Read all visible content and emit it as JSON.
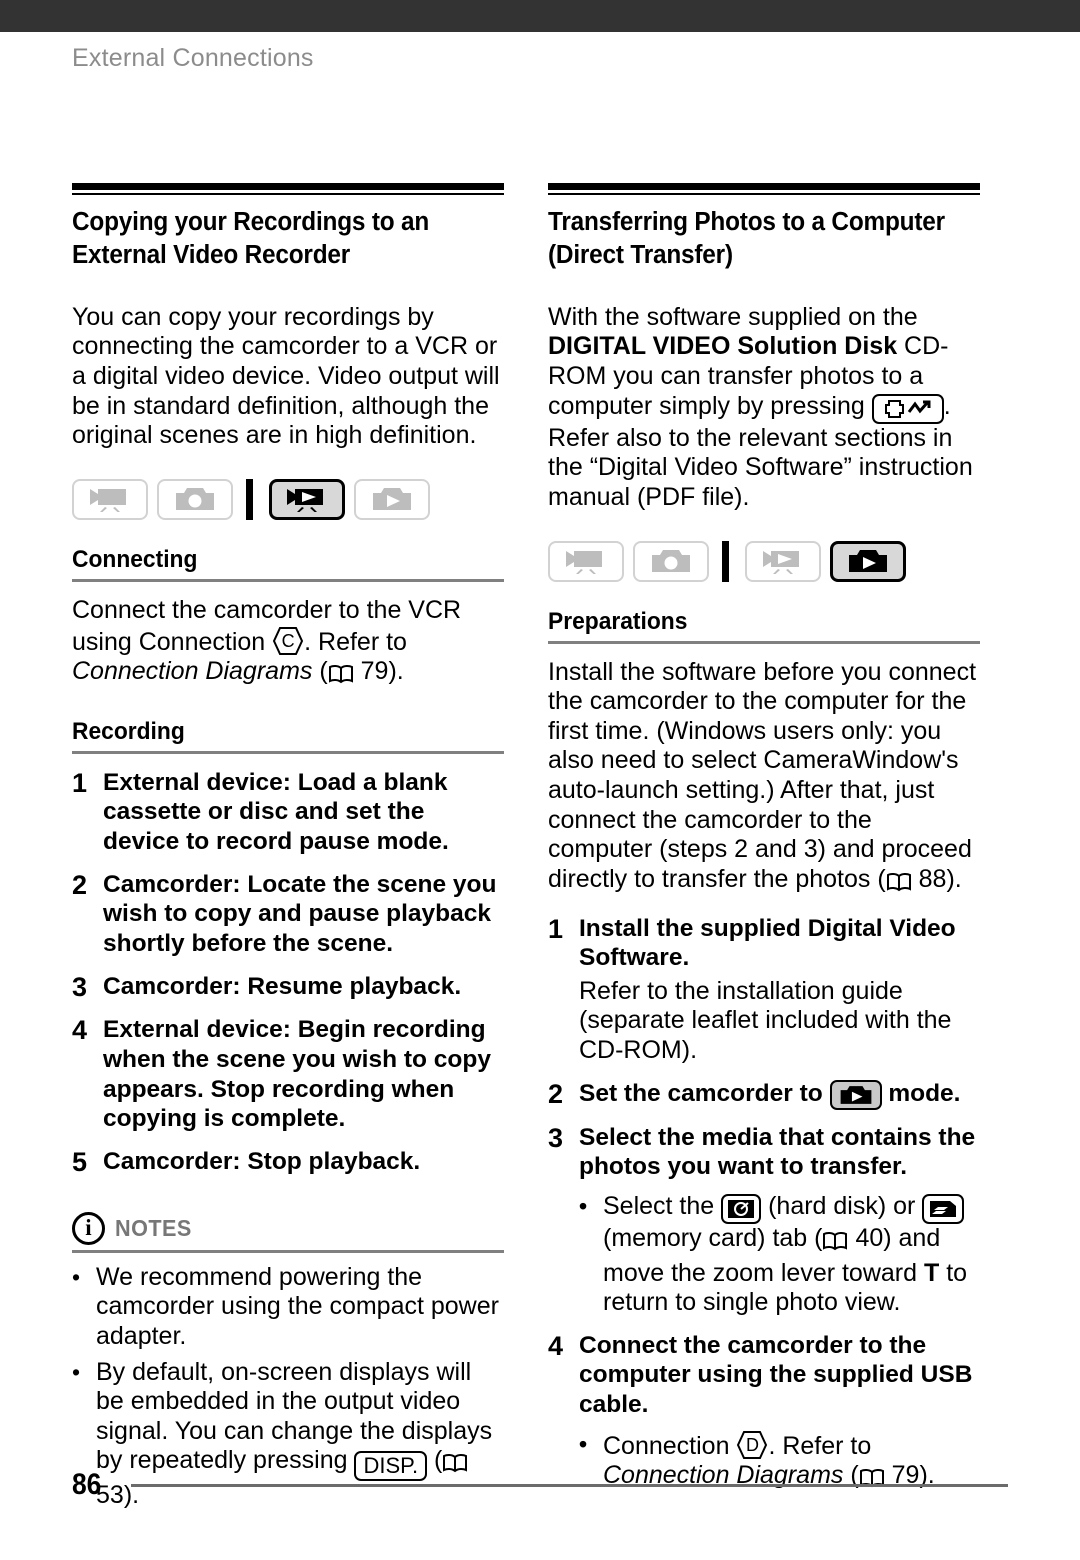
{
  "header": {
    "running_head": "External Connections"
  },
  "footer": {
    "page_number": "86"
  },
  "left_column": {
    "section_title": "Copying your Recordings to an External Video Recorder",
    "intro": "You can copy your recordings by connecting the camcorder to a VCR or a digital video device. Video output will be in standard definition, although the original scenes are in high definition.",
    "mode_icons": [
      {
        "name": "video-record-mode",
        "state": "inactive"
      },
      {
        "name": "photo-record-mode",
        "state": "inactive"
      },
      {
        "name": "video-playback-mode",
        "state": "active"
      },
      {
        "name": "photo-playback-mode",
        "state": "inactive"
      }
    ],
    "connecting": {
      "heading": "Connecting",
      "text_before": "Connect the camcorder to the VCR using Connection ",
      "connection_letter": "C",
      "text_after": ". Refer to ",
      "reference_italic": "Connection Diagrams",
      "reference_page": "79"
    },
    "recording": {
      "heading": "Recording",
      "steps": [
        {
          "num": "1",
          "text": "External device: Load a blank cassette or disc and set the device to record pause mode."
        },
        {
          "num": "2",
          "text": "Camcorder: Locate the scene you wish to copy and pause playback shortly before the scene."
        },
        {
          "num": "3",
          "text": "Camcorder: Resume playback."
        },
        {
          "num": "4",
          "text": "External device: Begin recording when the scene you wish to copy appears. Stop recording when copying is complete."
        },
        {
          "num": "5",
          "text": "Camcorder: Stop playback."
        }
      ]
    },
    "notes": {
      "label": "NOTES",
      "icon": "info-icon",
      "bullets": [
        {
          "text": "We recommend powering the camcorder using the compact power adapter."
        },
        {
          "text_before": "By default, on-screen displays will be embedded in the output video signal. You can change the displays by repeatedly pressing ",
          "button_label": "DISP.",
          "text_after": " (",
          "page": "53",
          "text_end": ")."
        }
      ]
    }
  },
  "right_column": {
    "section_title": "Transferring Photos to a Computer (Direct Transfer)",
    "intro": {
      "part1": "With the software supplied on the ",
      "bold1": "DIGITAL VIDEO Solution Disk",
      "part2": " CD-ROM you can transfer photos to a computer simply by pressing ",
      "button_icon": "print-share-icon",
      "part3": ". Refer also to the relevant sections in the “Digital Video Software” instruction manual (PDF file)."
    },
    "mode_icons": [
      {
        "name": "video-record-mode",
        "state": "inactive"
      },
      {
        "name": "photo-record-mode",
        "state": "inactive"
      },
      {
        "name": "video-playback-mode",
        "state": "inactive"
      },
      {
        "name": "photo-playback-mode",
        "state": "active"
      }
    ],
    "preparations": {
      "heading": "Preparations",
      "intro_before": "Install the software before you connect the camcorder to the computer for the first time. (Windows users only: you also need to select CameraWindow's auto-launch setting.) After that, just connect the camcorder to the computer (steps 2 and 3) and proceed directly to transfer the photos (",
      "intro_page": "88",
      "intro_after": ").",
      "steps": [
        {
          "num": "1",
          "text": "Install the supplied Digital Video Software.",
          "extra": "Refer to the installation guide (separate leaflet included with the CD-ROM)."
        },
        {
          "num": "2",
          "text_before": "Set the camcorder to ",
          "mode_icon": "photo-playback-mode",
          "text_after": " mode."
        },
        {
          "num": "3",
          "text": "Select the media that contains the photos you want to transfer.",
          "bullets": [
            {
              "before": "Select the ",
              "icon1": "hard-disk-icon",
              "mid1": " (hard disk) or ",
              "icon2": "memory-card-icon",
              "mid2": " (memory card) tab (",
              "page": "40",
              "mid3": ") and move the zoom lever toward ",
              "bold": "T",
              "after": " to return to single photo view."
            }
          ]
        },
        {
          "num": "4",
          "text": "Connect the camcorder to the computer using the supplied USB cable.",
          "bullets": [
            {
              "before": "Connection ",
              "connection_letter": "D",
              "mid": ". Refer to ",
              "italic": "Connection Diagrams",
              "after_open": " (",
              "page": "79",
              "after_close": ")."
            }
          ]
        }
      ]
    }
  }
}
